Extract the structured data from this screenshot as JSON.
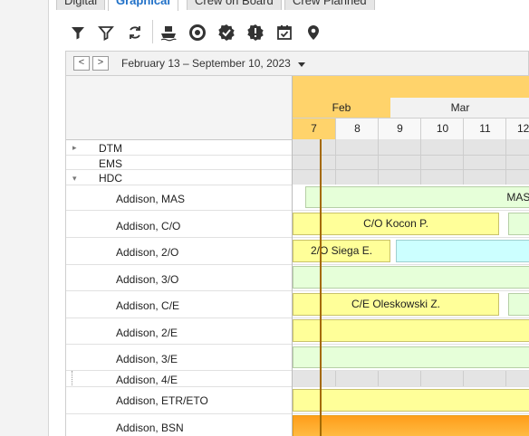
{
  "tabs": [
    {
      "label": "Digital",
      "active": false
    },
    {
      "label": "Graphical",
      "active": true
    },
    {
      "label": "Crew on Board",
      "active": false
    },
    {
      "label": "Crew Planned",
      "active": false
    }
  ],
  "toolbar": {
    "icons": [
      "filter-icon",
      "filter-outline-icon",
      "refresh-icon",
      "ship-icon",
      "lifebuoy-icon",
      "check-badge-icon",
      "alert-badge-icon",
      "calendar-check-icon",
      "map-pin-icon"
    ]
  },
  "datebar": {
    "prev_label": "<",
    "next_label": ">",
    "range": "February 13 – September 10, 2023"
  },
  "timeline": {
    "months": [
      "Feb",
      "Mar"
    ],
    "days": [
      "7",
      "8",
      "9",
      "10",
      "11",
      "12"
    ],
    "accent_color": "#ffd36b",
    "today_line_color": "#a46a00"
  },
  "groups": [
    {
      "label": "DTM",
      "expand": "▸"
    },
    {
      "label": "EMS",
      "expand": ""
    },
    {
      "label": "HDC",
      "expand": "▾"
    }
  ],
  "rows": [
    {
      "label": "Addison, MAS"
    },
    {
      "label": "Addison, C/O"
    },
    {
      "label": "Addison, 2/O"
    },
    {
      "label": "Addison, 3/O"
    },
    {
      "label": "Addison, C/E"
    },
    {
      "label": "Addison, 2/E"
    },
    {
      "label": "Addison, 3/E"
    },
    {
      "label": "Addison, 4/E"
    },
    {
      "label": "Addison, ETR/ETO"
    },
    {
      "label": "Addison, BSN"
    }
  ],
  "bars": {
    "mas": "MAS Z",
    "co": "C/O Kocon P.",
    "second_officer": "2/O Siega E.",
    "ce": "C/E Oleskowski Z."
  }
}
